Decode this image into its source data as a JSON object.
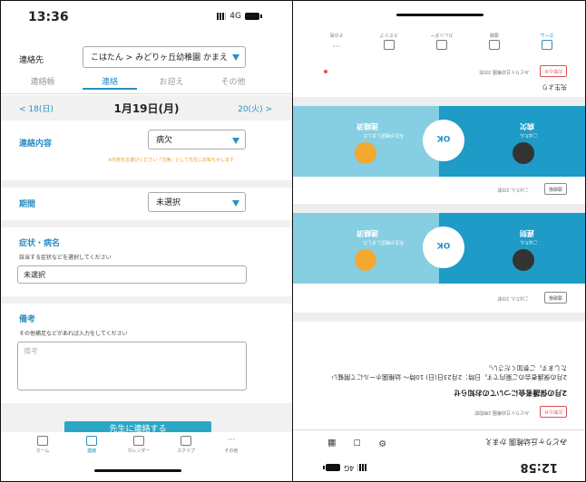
{
  "left": {
    "status": {
      "time": "13:36",
      "network": "4G"
    },
    "contact": {
      "label": "連絡先",
      "value": "こはたん > みどりヶ丘幼稚園 かまえ"
    },
    "tabs": [
      "連絡帳",
      "連絡",
      "お迎え",
      "その他"
    ],
    "date": {
      "prev": "< 18(日)",
      "current": "1月19日(月)",
      "next": "20(火) >"
    },
    "content": {
      "label": "連絡内容",
      "value": "病欠",
      "note": "※内容をお選びください「欠席」として先生にお知らせします"
    },
    "period": {
      "label": "期間",
      "value": "未選択"
    },
    "symptom": {
      "label": "症状・病名",
      "hint": "該当する症状などを選択してください",
      "value": "未選択"
    },
    "remarks": {
      "label": "備考",
      "hint": "その他補足などがあれば入力をしてください",
      "placeholder": "備考"
    },
    "submit": "先生に連絡する",
    "nav": [
      "ホーム",
      "連絡",
      "カレンダー",
      "スクリプ",
      "その他"
    ]
  },
  "right": {
    "status": {
      "time": "12:58",
      "network": "4G"
    },
    "school": "みどりヶ丘幼稚園 かまえ",
    "card1": {
      "badge": "お知らせ",
      "meta": "みどりヶ丘幼稚園 2時間前",
      "title": "2月の保護者会についてのお知らせ",
      "body": "2月の保護者会のご案内です。日時：2月23日(日) 10時〜 幼稚園ホールにて開催いたします。ご参加ください。"
    },
    "card2": {
      "badge": "連絡帳",
      "meta": "こはたん 1日前"
    },
    "band1": {
      "ok": "OK",
      "left_name": "連絡済",
      "right_name": "遅刻",
      "left_sub": "先生が確認しました",
      "right_sub": "こはたん"
    },
    "card3": {
      "badge": "連絡帳",
      "meta": "こはたん 2日前"
    },
    "band2": {
      "ok": "OK",
      "left_name": "連絡済",
      "right_name": "病欠",
      "left_sub": "先生が確認しました",
      "right_sub": "こはたん"
    },
    "card4": {
      "badge": "お知らせ",
      "meta": "みどりヶ丘幼稚園 3日前",
      "footer": "先生より"
    },
    "nav": [
      "ホーム",
      "連絡",
      "カレンダー",
      "スクリプ",
      "その他"
    ]
  }
}
